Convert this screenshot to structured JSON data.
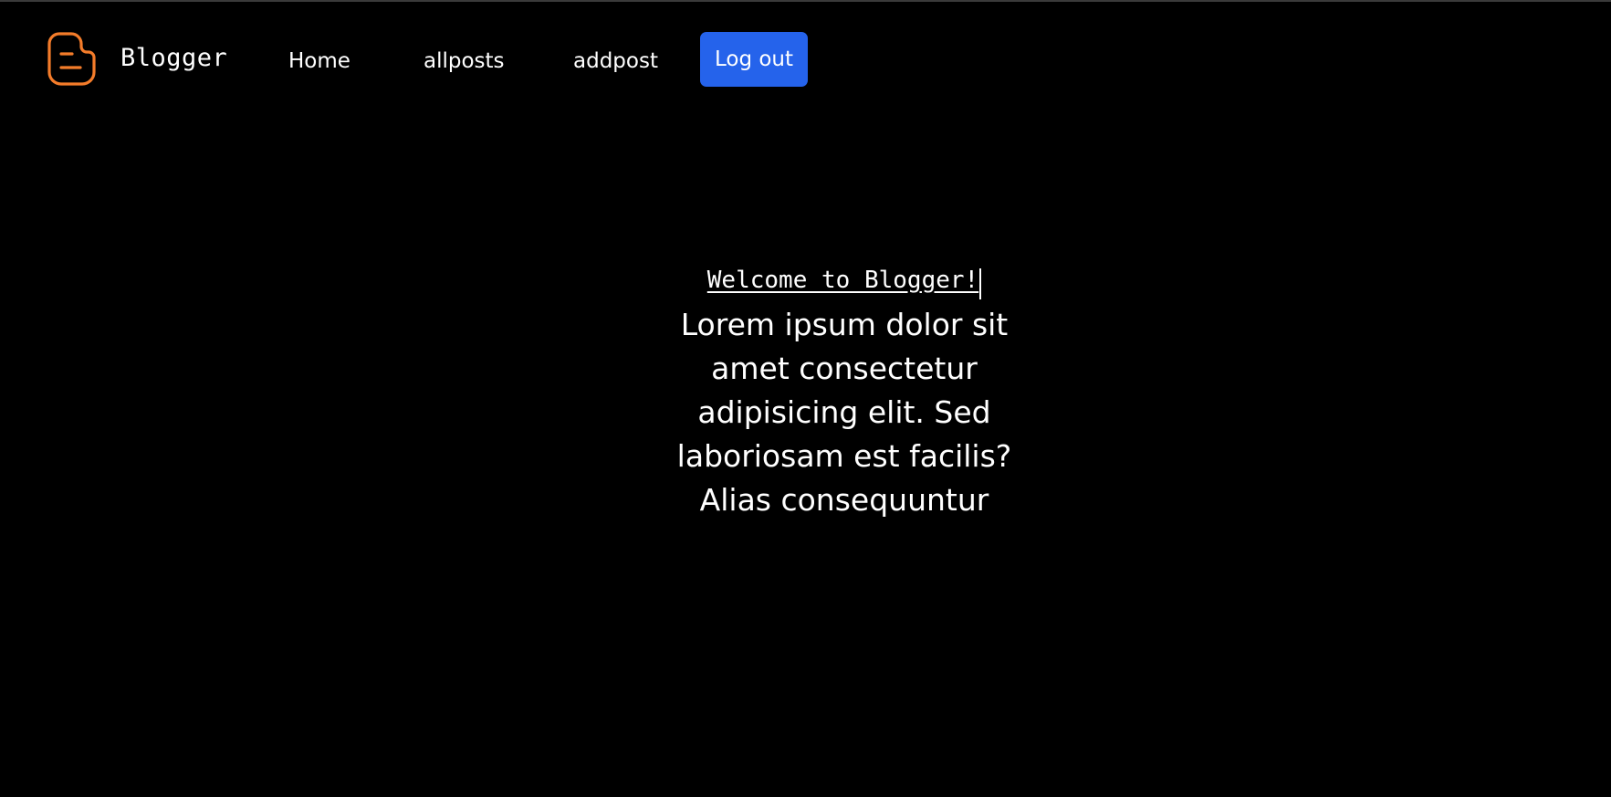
{
  "navbar": {
    "brand": "Blogger",
    "logo_icon": "blogger-logo-icon",
    "logo_color": "#f47c2a",
    "links": {
      "home": "Home",
      "allposts": "allposts",
      "addpost": "addpost"
    },
    "logout_label": "Log out",
    "logout_color": "#2563eb"
  },
  "hero": {
    "title": "Welcome to Blogger!",
    "body": "Lorem ipsum dolor sit amet consectetur adipisicing elit. Sed laboriosam est facilis? Alias consequuntur"
  }
}
